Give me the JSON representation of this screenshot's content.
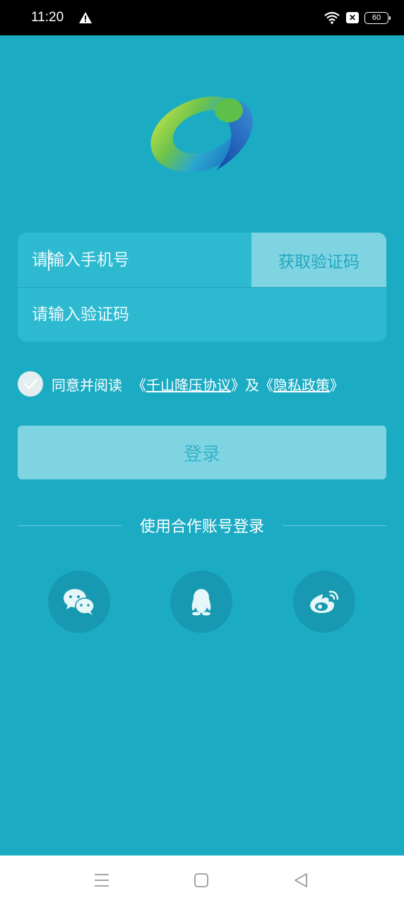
{
  "status_bar": {
    "time": "11:20",
    "battery": "60",
    "icons": [
      "alert-icon",
      "wifi-icon",
      "sim-off-icon",
      "battery-icon"
    ]
  },
  "logo": {
    "icon": "app-logo-icon"
  },
  "form": {
    "phone_placeholder": "请输入手机号",
    "get_code_label": "获取验证码",
    "code_placeholder": "请输入验证码"
  },
  "agreement": {
    "prefix": "同意并阅读",
    "open_quote_1": "《",
    "terms_link": "千山降压协议",
    "close_quote_1": "》",
    "conjunction": "及",
    "open_quote_2": "《",
    "privacy_link": "隐私政策",
    "close_quote_2": "》"
  },
  "login": {
    "label": "登录"
  },
  "partner": {
    "label": "使用合作账号登录",
    "items": [
      "wechat-icon",
      "qq-icon",
      "weibo-icon"
    ]
  },
  "nav": {
    "icons": [
      "menu-icon",
      "home-icon",
      "back-icon"
    ]
  },
  "colors": {
    "background": "#1bacc4",
    "card": "#2dbad0",
    "button_light": "#7fd4e2",
    "social_bg": "#1699b1"
  }
}
